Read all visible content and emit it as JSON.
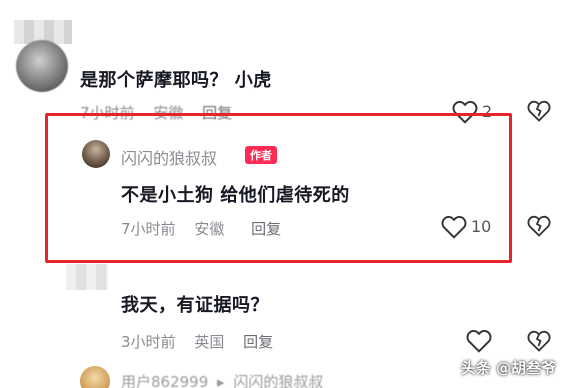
{
  "comments": [
    {
      "text": "是那个萨摩耶吗？ 小虎",
      "time": "7小时前",
      "location": "安徽",
      "reply_label": "回复",
      "likes": "2"
    },
    {
      "username": "闪闪的狼叔叔",
      "author_tag": "作者",
      "text": "不是小土狗 给他们虐待死的",
      "time": "7小时前",
      "location": "安徽",
      "reply_label": "回复",
      "likes": "10"
    },
    {
      "text": "我天，有证据吗？",
      "time": "3小时前",
      "location": "英国",
      "reply_label": "回复"
    },
    {
      "username": "用户862999",
      "reply_arrow": "▸",
      "reply_to": "闪闪的狼叔叔"
    }
  ],
  "watermark": "头条 @胡叁爷",
  "colors": {
    "highlight": "#e8242b",
    "author_tag": "#fe2c55"
  }
}
